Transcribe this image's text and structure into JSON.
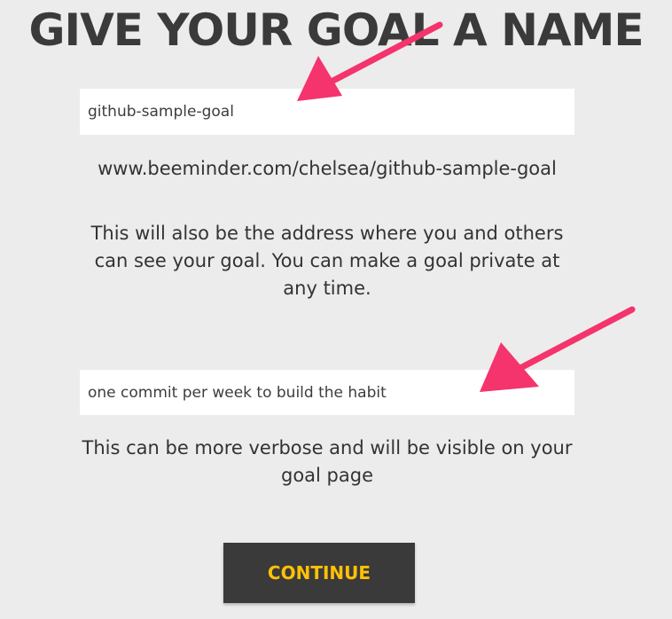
{
  "header": {
    "title": "GIVE YOUR GOAL A NAME"
  },
  "goal_name": {
    "value": "github-sample-goal",
    "url": "www.beeminder.com/chelsea/github-sample-goal",
    "help": "This will also be the address where you and others can see your goal. You can make a goal private at any time."
  },
  "goal_description": {
    "value": "one commit per week to build the habit",
    "help": "This can be more verbose and will be visible on your goal page"
  },
  "actions": {
    "continue_label": "CONTINUE"
  },
  "colors": {
    "background": "#ececec",
    "button": "#3a3a3a",
    "button_text": "#ffc107",
    "annotation_arrow": "#f5336c"
  }
}
